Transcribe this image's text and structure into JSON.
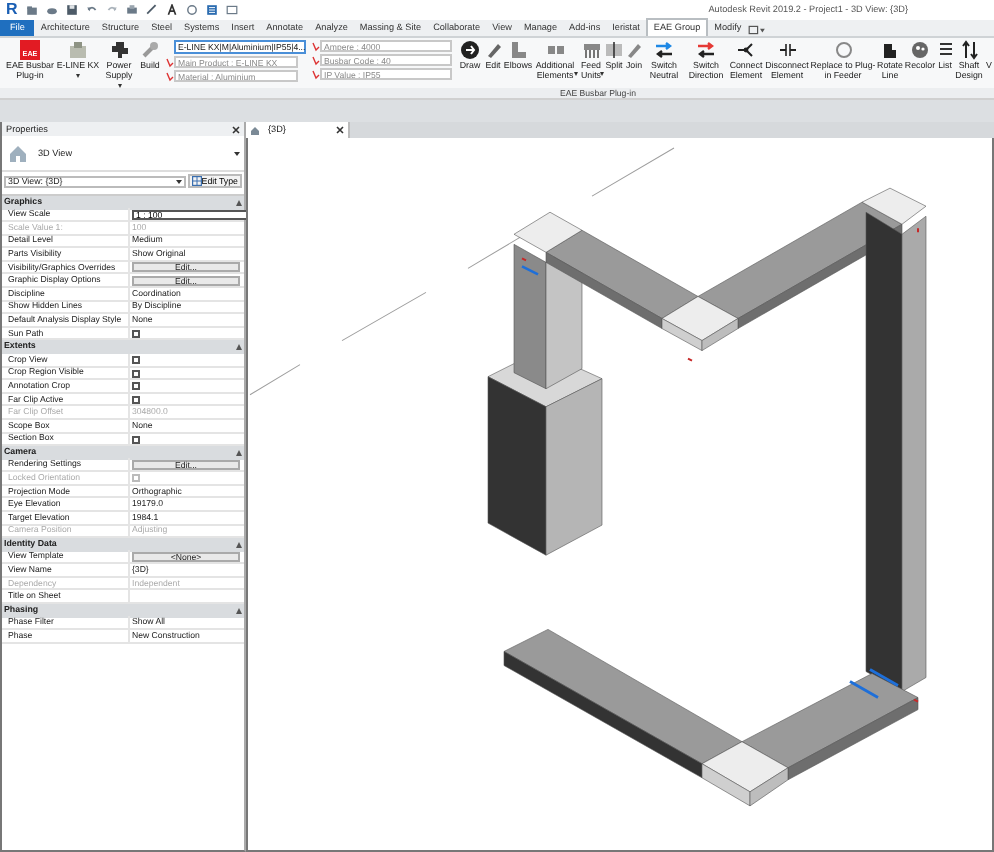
{
  "title_bar": {
    "app_logo": "R",
    "title": "Autodesk Revit 2019.2 - Project1 - 3D View: {3D}"
  },
  "menu_tabs": [
    {
      "label": "File",
      "kind": "file",
      "selected": false
    },
    {
      "label": "Architecture",
      "kind": "tab",
      "selected": false
    },
    {
      "label": "Structure",
      "kind": "tab",
      "selected": false
    },
    {
      "label": "Steel",
      "kind": "tab",
      "selected": false
    },
    {
      "label": "Systems",
      "kind": "tab",
      "selected": false
    },
    {
      "label": "Insert",
      "kind": "tab",
      "selected": false
    },
    {
      "label": "Annotate",
      "kind": "tab",
      "selected": false
    },
    {
      "label": "Analyze",
      "kind": "tab",
      "selected": false
    },
    {
      "label": "Massing & Site",
      "kind": "tab",
      "selected": false
    },
    {
      "label": "Collaborate",
      "kind": "tab",
      "selected": false
    },
    {
      "label": "View",
      "kind": "tab",
      "selected": false
    },
    {
      "label": "Manage",
      "kind": "tab",
      "selected": false
    },
    {
      "label": "Add-ins",
      "kind": "tab",
      "selected": false
    },
    {
      "label": "Ieristat",
      "kind": "tab",
      "selected": false
    },
    {
      "label": "EAE Group",
      "kind": "tab",
      "selected": true
    },
    {
      "label": "Modify",
      "kind": "tab",
      "selected": false
    }
  ],
  "ribbon": {
    "logo_text": "EAE",
    "tools_left": [
      {
        "label": "EAE Busbar Plug-in",
        "dropdown": false
      },
      {
        "label": "E-LINE KX",
        "dropdown": true
      },
      {
        "label": "Power Supply",
        "dropdown": true
      },
      {
        "label": "Build",
        "dropdown": false
      }
    ],
    "selector": {
      "value": "E-LINE KX|M|Aluminium|IP55|4..."
    },
    "fields": [
      {
        "placeholder": "Main Product : E-LINE KX"
      },
      {
        "placeholder": "Material : Aluminium"
      },
      {
        "placeholder": "Ampere : 4000"
      },
      {
        "placeholder": "Busbar Code : 40"
      },
      {
        "placeholder": "IP Value : IP55"
      }
    ],
    "tools": [
      {
        "label": "Draw",
        "dropdown": false
      },
      {
        "label": "Edit",
        "dropdown": false
      },
      {
        "label": "Elbows",
        "dropdown": false
      },
      {
        "label": "Additional Elements",
        "dropdown": true
      },
      {
        "label": "Feed Units",
        "dropdown": true
      },
      {
        "label": "Split",
        "dropdown": false
      },
      {
        "label": "Join",
        "dropdown": false
      },
      {
        "label": "Switch Neutral",
        "dropdown": false
      },
      {
        "label": "Switch Direction",
        "dropdown": false
      },
      {
        "label": "Connect Element",
        "dropdown": false
      },
      {
        "label": "Disconnect Element",
        "dropdown": false
      },
      {
        "label": "Replace to Plug-in Feeder",
        "dropdown": false
      },
      {
        "label": "Rotate Line",
        "dropdown": false
      },
      {
        "label": "Recolor",
        "dropdown": false
      },
      {
        "label": "List",
        "dropdown": false
      },
      {
        "label": "Shaft Design",
        "dropdown": false
      },
      {
        "label": "V",
        "dropdown": false
      }
    ],
    "panel_label": "EAE Busbar Plug-in"
  },
  "properties": {
    "title": "Properties",
    "type_name": "3D View",
    "instance": "3D View: {3D}",
    "edit_type": "Edit Type",
    "sections": [
      {
        "title": "Graphics",
        "rows": [
          {
            "label": "View Scale",
            "value": "1 : 100",
            "kind": "input",
            "disabled": false
          },
          {
            "label": "Scale Value    1:",
            "value": "100",
            "kind": "text",
            "disabled": true
          },
          {
            "label": "Detail Level",
            "value": "Medium",
            "kind": "text",
            "disabled": false
          },
          {
            "label": "Parts Visibility",
            "value": "Show Original",
            "kind": "text",
            "disabled": false
          },
          {
            "label": "Visibility/Graphics Overrides",
            "value": "Edit...",
            "kind": "button",
            "disabled": false
          },
          {
            "label": "Graphic Display Options",
            "value": "Edit...",
            "kind": "button",
            "disabled": false
          },
          {
            "label": "Discipline",
            "value": "Coordination",
            "kind": "text",
            "disabled": false
          },
          {
            "label": "Show Hidden Lines",
            "value": "By Discipline",
            "kind": "text",
            "disabled": false
          },
          {
            "label": "Default Analysis Display Style",
            "value": "None",
            "kind": "text",
            "disabled": false
          },
          {
            "label": "Sun Path",
            "kind": "check",
            "checked": false,
            "disabled": false
          }
        ]
      },
      {
        "title": "Extents",
        "rows": [
          {
            "label": "Crop View",
            "kind": "check",
            "checked": false,
            "disabled": false
          },
          {
            "label": "Crop Region Visible",
            "kind": "check",
            "checked": false,
            "disabled": false
          },
          {
            "label": "Annotation Crop",
            "kind": "check",
            "checked": false,
            "disabled": false
          },
          {
            "label": "Far Clip Active",
            "kind": "check",
            "checked": false,
            "disabled": false
          },
          {
            "label": "Far Clip Offset",
            "value": "304800.0",
            "kind": "text",
            "disabled": true
          },
          {
            "label": "Scope Box",
            "value": "None",
            "kind": "text",
            "disabled": false
          },
          {
            "label": "Section Box",
            "kind": "check",
            "checked": false,
            "disabled": false
          }
        ]
      },
      {
        "title": "Camera",
        "rows": [
          {
            "label": "Rendering Settings",
            "value": "Edit...",
            "kind": "button",
            "disabled": false
          },
          {
            "label": "Locked Orientation",
            "kind": "check",
            "checked": false,
            "disabled": true
          },
          {
            "label": "Projection Mode",
            "value": "Orthographic",
            "kind": "text",
            "disabled": false
          },
          {
            "label": "Eye Elevation",
            "value": "19179.0",
            "kind": "text",
            "disabled": false
          },
          {
            "label": "Target Elevation",
            "value": "1984.1",
            "kind": "text",
            "disabled": false
          },
          {
            "label": "Camera Position",
            "value": "Adjusting",
            "kind": "text",
            "disabled": true
          }
        ]
      },
      {
        "title": "Identity Data",
        "rows": [
          {
            "label": "View Template",
            "value": "<None>",
            "kind": "button",
            "disabled": false
          },
          {
            "label": "View Name",
            "value": "{3D}",
            "kind": "text",
            "disabled": false
          },
          {
            "label": "Dependency",
            "value": "Independent",
            "kind": "text",
            "disabled": true
          },
          {
            "label": "Title on Sheet",
            "kind": "text",
            "disabled": false
          }
        ]
      },
      {
        "title": "Phasing",
        "rows": [
          {
            "label": "Phase Filter",
            "value": "Show All",
            "kind": "text",
            "disabled": false
          },
          {
            "label": "Phase",
            "value": "New Construction",
            "kind": "text",
            "disabled": false
          }
        ]
      }
    ]
  },
  "view": {
    "tab": "{3D}"
  }
}
